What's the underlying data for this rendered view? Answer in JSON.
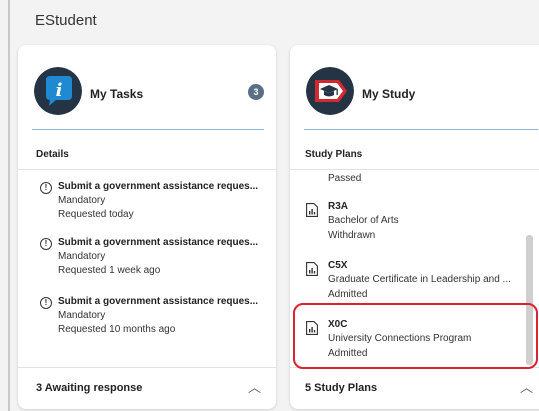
{
  "app": {
    "title": "EStudent"
  },
  "tasks_card": {
    "title": "My Tasks",
    "badge_count": "3",
    "section_title": "Details",
    "items": [
      {
        "title": "Submit a government assistance reques...",
        "type": "Mandatory",
        "requested": "Requested today"
      },
      {
        "title": "Submit a government assistance reques...",
        "type": "Mandatory",
        "requested": "Requested 1 week ago"
      },
      {
        "title": "Submit a government assistance reques...",
        "type": "Mandatory",
        "requested": "Requested 10 months ago"
      }
    ],
    "footer_label": "3  Awaiting response",
    "icon": "info-icon"
  },
  "study_card": {
    "title": "My Study",
    "section_title": "Study Plans",
    "partial_status": "Passed",
    "plans": [
      {
        "code": "R3A",
        "name": "Bachelor of Arts",
        "status": "Withdrawn"
      },
      {
        "code": "C5X",
        "name": "Graduate Certificate in Leadership and ...",
        "status": "Admitted"
      },
      {
        "code": "X0C",
        "name": "University Connections Program",
        "status": "Admitted"
      }
    ],
    "footer_label": "5  Study Plans",
    "icon": "graduation-cap-icon"
  },
  "colors": {
    "highlight": "#d9232d",
    "icon_blue": "#1f7fc4",
    "icon_dark": "#2b3a4a",
    "icon_red": "#d12a30"
  }
}
